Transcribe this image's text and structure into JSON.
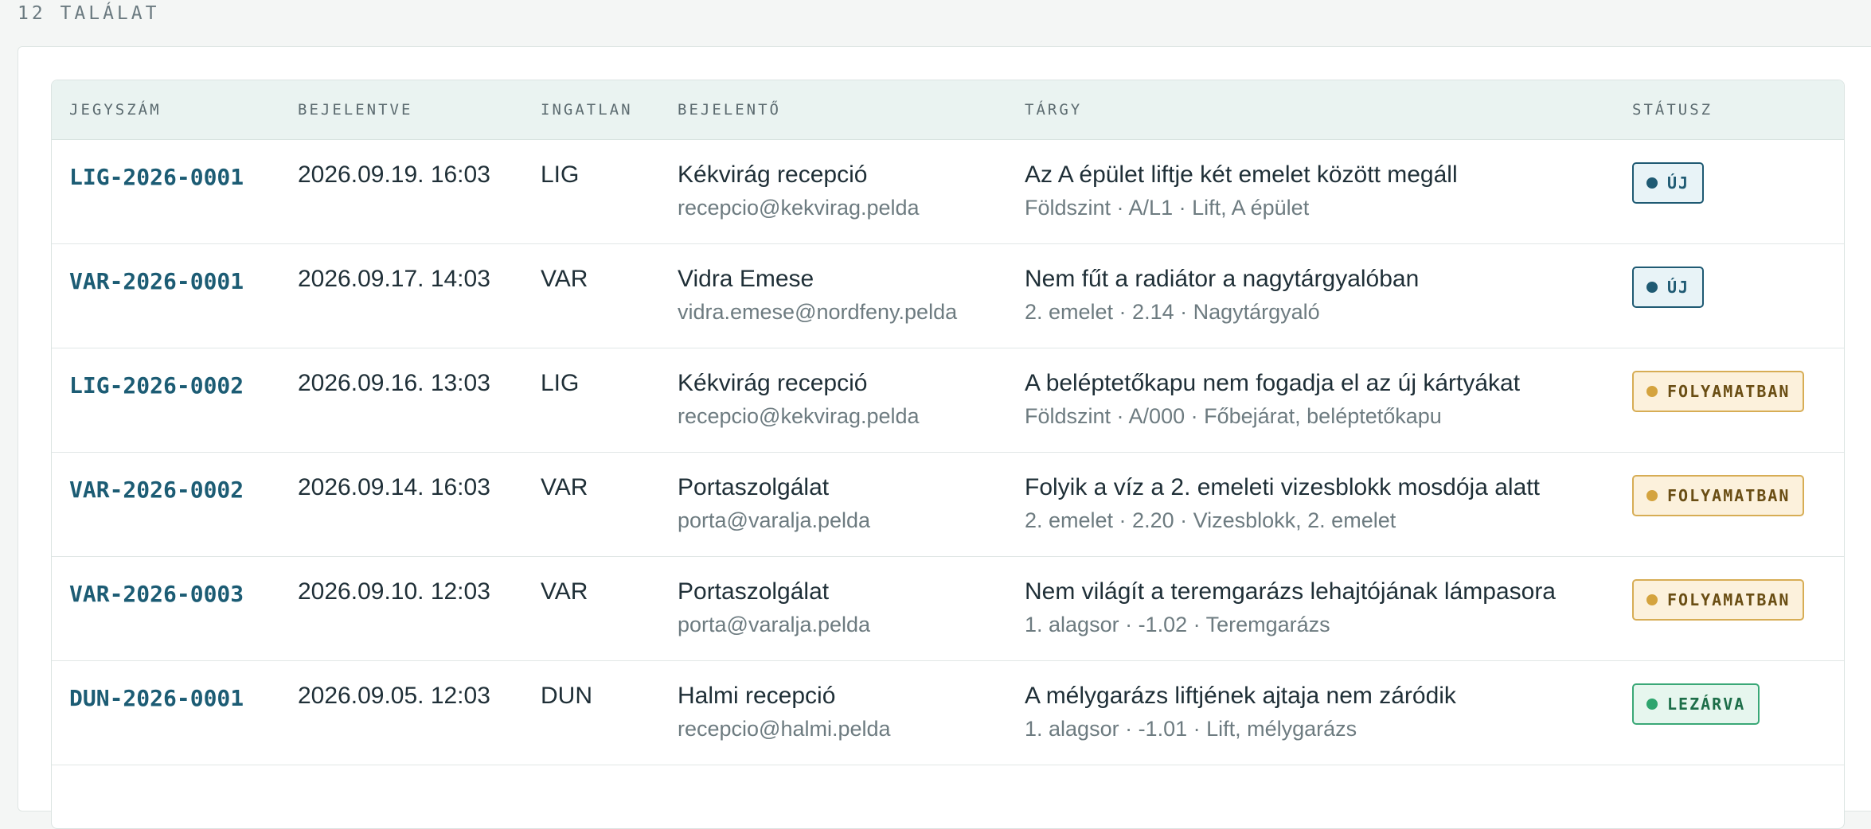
{
  "result_count": "12 TALÁLAT",
  "table": {
    "headers": [
      "JEGYSZÁM",
      "BEJELENTVE",
      "INGATLAN",
      "BEJELENTŐ",
      "TÁRGY",
      "STÁTUSZ"
    ],
    "rows": [
      {
        "id": "LIG-2026-0001",
        "reported": "2026.09.19. 16:03",
        "property": "LIG",
        "reporter_name": "Kékvirág recepció",
        "reporter_email": "recepcio@kekvirag.pelda",
        "subject": "Az A épület liftje két emelet között megáll",
        "location": "Földszint · A/L1 · Lift, A épület",
        "status": "ÚJ",
        "status_kind": "new"
      },
      {
        "id": "VAR-2026-0001",
        "reported": "2026.09.17. 14:03",
        "property": "VAR",
        "reporter_name": "Vidra Emese",
        "reporter_email": "vidra.emese@nordfeny.pelda",
        "subject": "Nem fűt a radiátor a nagytárgyalóban",
        "location": "2. emelet · 2.14 · Nagytárgyaló",
        "status": "ÚJ",
        "status_kind": "new"
      },
      {
        "id": "LIG-2026-0002",
        "reported": "2026.09.16. 13:03",
        "property": "LIG",
        "reporter_name": "Kékvirág recepció",
        "reporter_email": "recepcio@kekvirag.pelda",
        "subject": "A beléptetőkapu nem fogadja el az új kártyákat",
        "location": "Földszint · A/000 · Főbejárat, beléptetőkapu",
        "status": "FOLYAMATBAN",
        "status_kind": "progress"
      },
      {
        "id": "VAR-2026-0002",
        "reported": "2026.09.14. 16:03",
        "property": "VAR",
        "reporter_name": "Portaszolgálat",
        "reporter_email": "porta@varalja.pelda",
        "subject": "Folyik a víz a 2. emeleti vizesblokk mosdója alatt",
        "location": "2. emelet · 2.20 · Vizesblokk, 2. emelet",
        "status": "FOLYAMATBAN",
        "status_kind": "progress"
      },
      {
        "id": "VAR-2026-0003",
        "reported": "2026.09.10. 12:03",
        "property": "VAR",
        "reporter_name": "Portaszolgálat",
        "reporter_email": "porta@varalja.pelda",
        "subject": "Nem világít a teremgarázs lehajtójának lámpasora",
        "location": "1. alagsor · -1.02 · Teremgarázs",
        "status": "FOLYAMATBAN",
        "status_kind": "progress"
      },
      {
        "id": "DUN-2026-0001",
        "reported": "2026.09.05. 12:03",
        "property": "DUN",
        "reporter_name": "Halmi recepció",
        "reporter_email": "recepcio@halmi.pelda",
        "subject": "A mélygarázs liftjének ajtaja nem záródik",
        "location": "1. alagsor · -1.01 · Lift, mélygarázs",
        "status": "LEZÁRVA",
        "status_kind": "closed"
      }
    ]
  },
  "colors": {
    "ticket_link": "#1c5c74",
    "status_new": "#1f5a73",
    "status_progress": "#d4a33e",
    "status_closed": "#2ea56e",
    "header_bg": "#eaf3f1"
  }
}
